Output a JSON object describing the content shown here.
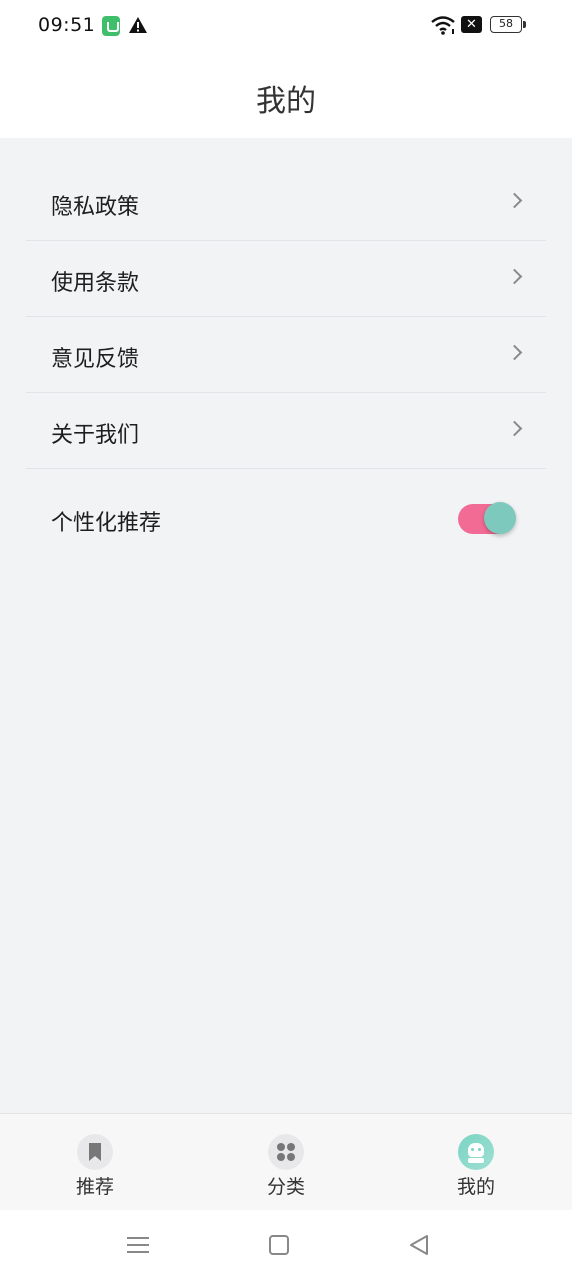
{
  "status_bar": {
    "time": "09:51",
    "icons": [
      "app-notification-icon",
      "warning-icon",
      "wifi-icon",
      "no-sim-icon"
    ],
    "battery": "58"
  },
  "header": {
    "title": "我的"
  },
  "menu": {
    "items": [
      {
        "label": "隐私政策"
      },
      {
        "label": "使用条款"
      },
      {
        "label": "意见反馈"
      },
      {
        "label": "关于我们"
      }
    ],
    "personalized": {
      "label": "个性化推荐",
      "enabled": true
    }
  },
  "tab_bar": {
    "tabs": [
      {
        "label": "推荐",
        "icon": "bookmark-icon"
      },
      {
        "label": "分类",
        "icon": "grid-dots-icon"
      },
      {
        "label": "我的",
        "icon": "robot-avatar-icon",
        "active": true
      }
    ]
  },
  "colors": {
    "toggle_track": "#f26b95",
    "toggle_knob": "#7dc9bd",
    "active_tab_icon": "#7ad4c2",
    "background": "#f2f3f5"
  }
}
